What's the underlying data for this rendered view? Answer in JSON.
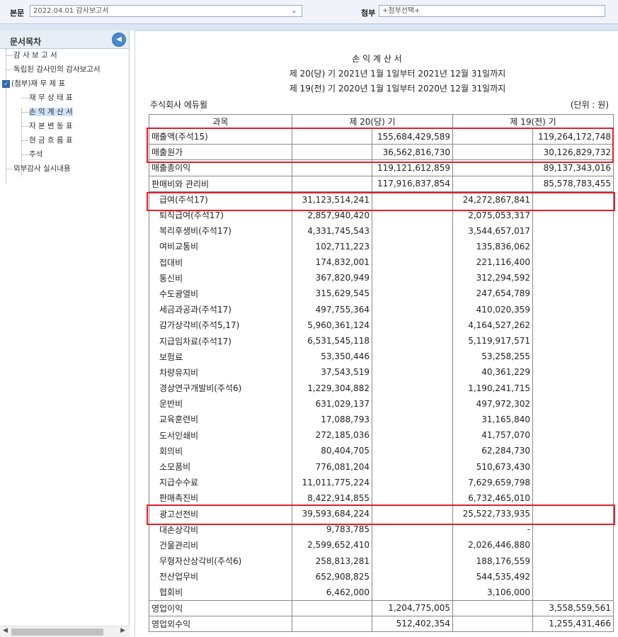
{
  "toolbar": {
    "main_label": "본문",
    "main_value": "2022.04.01  감사보고서",
    "attach_label": "첨부",
    "attach_value": "+첨부선택+"
  },
  "sidebar": {
    "title": "문서목차",
    "items": [
      {
        "label": "감 사 보 고 서"
      },
      {
        "label": "독립된 감사인의 감사보고서"
      },
      {
        "label": "(첨부)재 무 제 표"
      },
      {
        "label": "재 무 상 태 표"
      },
      {
        "label": "손 익 계 산 서"
      },
      {
        "label": "자 본 변 동 표"
      },
      {
        "label": "현 금 흐 름 표"
      },
      {
        "label": "주석"
      },
      {
        "label": "외부감사 실시내용"
      }
    ]
  },
  "doc": {
    "title": "손 익 계 산 서",
    "period_current": "제 20(당) 기 2021년 1월 1일부터 2021년 12월 31일까지",
    "period_prior": "제 19(전) 기 2020년 1월 1일부터 2020년 12월 31일까지",
    "company": "주식회사 에듀윌",
    "unit": "(단위 : 원)",
    "headers": [
      "과목",
      "제 20(당) 기",
      "제 19(전) 기"
    ],
    "rows": [
      {
        "label": "매출액(주석15)",
        "c1": "",
        "c2": "155,684,429,589",
        "p1": "",
        "p2": "119,264,172,748",
        "indent": false
      },
      {
        "label": "매출원가",
        "c1": "",
        "c2": "36,562,816,730",
        "p1": "",
        "p2": "30,126,829,732",
        "indent": false
      },
      {
        "label": "매출총이익",
        "c1": "",
        "c2": "119,121,612,859",
        "p1": "",
        "p2": "89,137,343,016",
        "indent": false
      },
      {
        "label": "판매비와 관리비",
        "c1": "",
        "c2": "117,916,837,854",
        "p1": "",
        "p2": "85,578,783,455",
        "indent": false
      },
      {
        "label": "급여(주석17)",
        "c1": "31,123,514,241",
        "c2": "",
        "p1": "24,272,867,841",
        "p2": "",
        "indent": true
      },
      {
        "label": "퇴직급여(주석17)",
        "c1": "2,857,940,420",
        "c2": "",
        "p1": "2,075,053,317",
        "p2": "",
        "indent": true
      },
      {
        "label": "복리후생비(주석17)",
        "c1": "4,331,745,543",
        "c2": "",
        "p1": "3,544,657,017",
        "p2": "",
        "indent": true
      },
      {
        "label": "여비교통비",
        "c1": "102,711,223",
        "c2": "",
        "p1": "135,836,062",
        "p2": "",
        "indent": true
      },
      {
        "label": "접대비",
        "c1": "174,832,001",
        "c2": "",
        "p1": "221,116,400",
        "p2": "",
        "indent": true
      },
      {
        "label": "통신비",
        "c1": "367,820,949",
        "c2": "",
        "p1": "312,294,592",
        "p2": "",
        "indent": true
      },
      {
        "label": "수도광열비",
        "c1": "315,629,545",
        "c2": "",
        "p1": "247,654,789",
        "p2": "",
        "indent": true
      },
      {
        "label": "세금과공과(주석17)",
        "c1": "497,755,364",
        "c2": "",
        "p1": "410,020,359",
        "p2": "",
        "indent": true
      },
      {
        "label": "감가상각비(주석5,17)",
        "c1": "5,960,361,124",
        "c2": "",
        "p1": "4,164,527,262",
        "p2": "",
        "indent": true
      },
      {
        "label": "지급임차료(주석17)",
        "c1": "6,531,545,118",
        "c2": "",
        "p1": "5,119,917,571",
        "p2": "",
        "indent": true
      },
      {
        "label": "보험료",
        "c1": "53,350,446",
        "c2": "",
        "p1": "53,258,255",
        "p2": "",
        "indent": true
      },
      {
        "label": "차량유지비",
        "c1": "37,543,519",
        "c2": "",
        "p1": "40,361,229",
        "p2": "",
        "indent": true
      },
      {
        "label": "경상연구개발비(주석6)",
        "c1": "1,229,304,882",
        "c2": "",
        "p1": "1,190,241,715",
        "p2": "",
        "indent": true
      },
      {
        "label": "운반비",
        "c1": "631,029,137",
        "c2": "",
        "p1": "497,972,302",
        "p2": "",
        "indent": true
      },
      {
        "label": "교육훈련비",
        "c1": "17,088,793",
        "c2": "",
        "p1": "31,165,840",
        "p2": "",
        "indent": true
      },
      {
        "label": "도서인쇄비",
        "c1": "272,185,036",
        "c2": "",
        "p1": "41,757,070",
        "p2": "",
        "indent": true
      },
      {
        "label": "회의비",
        "c1": "80,404,705",
        "c2": "",
        "p1": "62,284,730",
        "p2": "",
        "indent": true
      },
      {
        "label": "소모품비",
        "c1": "776,081,204",
        "c2": "",
        "p1": "510,673,430",
        "p2": "",
        "indent": true
      },
      {
        "label": "지급수수료",
        "c1": "11,011,775,224",
        "c2": "",
        "p1": "7,629,659,798",
        "p2": "",
        "indent": true
      },
      {
        "label": "판매촉진비",
        "c1": "8,422,914,855",
        "c2": "",
        "p1": "6,732,465,010",
        "p2": "",
        "indent": true
      },
      {
        "label": "광고선전비",
        "c1": "39,593,684,224",
        "c2": "",
        "p1": "25,522,733,935",
        "p2": "",
        "indent": true
      },
      {
        "label": "대손상각비",
        "c1": "9,783,785",
        "c2": "",
        "p1": "-",
        "p2": "",
        "indent": true
      },
      {
        "label": "건물관리비",
        "c1": "2,599,652,410",
        "c2": "",
        "p1": "2,026,446,880",
        "p2": "",
        "indent": true
      },
      {
        "label": "무형자산상각비(주석6)",
        "c1": "258,813,281",
        "c2": "",
        "p1": "188,176,559",
        "p2": "",
        "indent": true
      },
      {
        "label": "전산업무비",
        "c1": "652,908,825",
        "c2": "",
        "p1": "544,535,492",
        "p2": "",
        "indent": true
      },
      {
        "label": "협회비",
        "c1": "6,462,000",
        "c2": "",
        "p1": "3,106,000",
        "p2": "",
        "indent": true
      },
      {
        "label": "영업이익",
        "c1": "",
        "c2": "1,204,775,005",
        "p1": "",
        "p2": "3,558,559,561",
        "indent": false
      },
      {
        "label": "영업외수익",
        "c1": "",
        "c2": "512,402,354",
        "p1": "",
        "p2": "1,255,431,466",
        "indent": false
      }
    ]
  },
  "highlight_color": "#e0202a"
}
